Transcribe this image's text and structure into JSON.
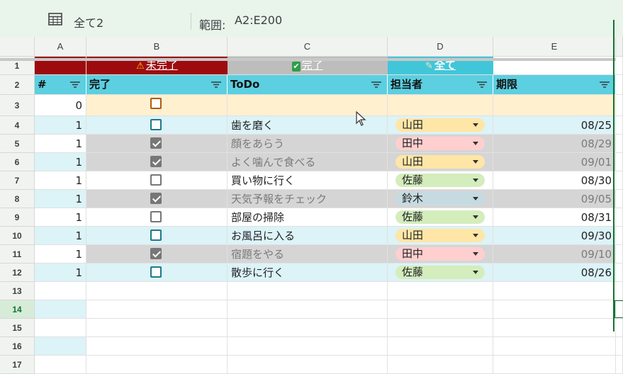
{
  "toolbar": {
    "table_icon": "table-icon",
    "sheet_name": "全て2",
    "range_label": "範囲:",
    "range_value": "A2:E200"
  },
  "columns": [
    "A",
    "B",
    "C",
    "D",
    "E"
  ],
  "row_numbers": [
    "1",
    "2",
    "3",
    "4",
    "5",
    "6",
    "7",
    "8",
    "9",
    "10",
    "11",
    "12",
    "13",
    "14",
    "15",
    "16",
    "17"
  ],
  "filter_row": {
    "incomplete_icon": "warning-icon",
    "incomplete_label": "未完了",
    "complete_icon": "checkmark-icon",
    "complete_label": "完了",
    "all_icon": "memo-icon",
    "all_label": "全て",
    "colors": {
      "incomplete": "#9e0b0f",
      "complete": "#bdbdbd",
      "all": "#41c6d9"
    }
  },
  "headers": {
    "num": "#",
    "done": "完了",
    "todo": "ToDo",
    "assignee": "担当者",
    "due": "期限"
  },
  "rows": [
    {
      "num": "0",
      "done": "empty",
      "todo": "",
      "assignee": "",
      "due": ""
    },
    {
      "num": "1",
      "done": "unchecked",
      "todo": "歯を磨く",
      "assignee": "山田",
      "due": "08/25"
    },
    {
      "num": "1",
      "done": "checked",
      "todo": "顔をあらう",
      "assignee": "田中",
      "due": "08/29"
    },
    {
      "num": "1",
      "done": "checked",
      "todo": "よく噛んで食べる",
      "assignee": "山田",
      "due": "09/01"
    },
    {
      "num": "1",
      "done": "unchecked",
      "todo": "買い物に行く",
      "assignee": "佐藤",
      "due": "08/30"
    },
    {
      "num": "1",
      "done": "checked",
      "todo": "天気予報をチェック",
      "assignee": "鈴木",
      "due": "09/05"
    },
    {
      "num": "1",
      "done": "unchecked",
      "todo": "部屋の掃除",
      "assignee": "佐藤",
      "due": "08/31"
    },
    {
      "num": "1",
      "done": "unchecked",
      "todo": "お風呂に入る",
      "assignee": "山田",
      "due": "09/30"
    },
    {
      "num": "1",
      "done": "checked",
      "todo": "宿題をやる",
      "assignee": "田中",
      "due": "09/10"
    },
    {
      "num": "1",
      "done": "unchecked",
      "todo": "散歩に行く",
      "assignee": "佐藤",
      "due": "08/26"
    }
  ],
  "assignee_colors": {
    "山田": "#ffe6a6",
    "田中": "#ffcfcf",
    "佐藤": "#d4edbc",
    "鈴木": "#c6dbe1"
  }
}
